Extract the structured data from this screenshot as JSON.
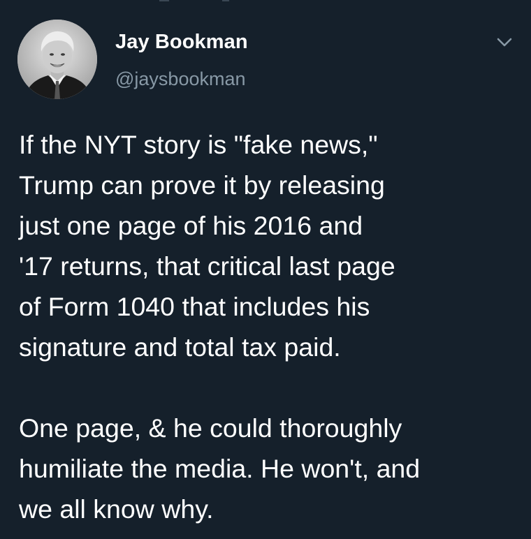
{
  "tweet": {
    "author": {
      "display_name": "Jay Bookman",
      "handle": "@jaysbookman"
    },
    "menu_icon": "chevron-down-icon",
    "text_paragraph_1": "If the NYT story is \"fake news,\"\nTrump can prove it by releasing\njust one page of his 2016 and\n'17 returns, that critical last page\nof Form 1040 that includes his\nsignature and total tax paid.",
    "text_paragraph_2": "One page, & he could thoroughly\nhumiliate the media. He won't, and\nwe all know why."
  },
  "colors": {
    "background": "#15202b",
    "primary_text": "#ffffff",
    "secondary_text": "#8899a6"
  }
}
